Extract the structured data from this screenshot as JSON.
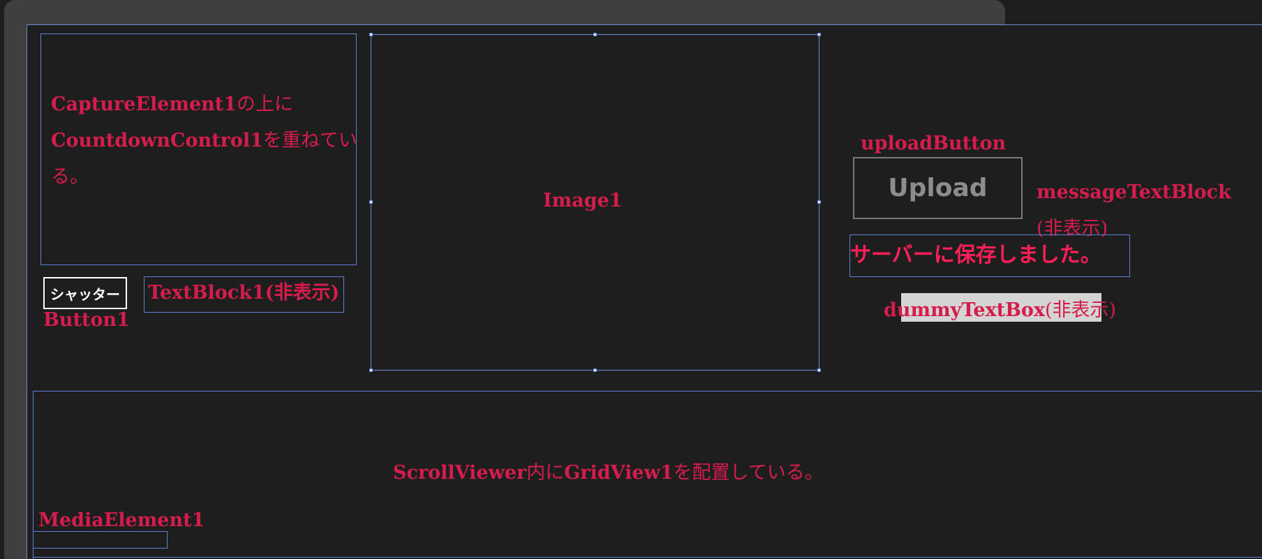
{
  "capture_note": {
    "part1_bold": "CaptureElement1",
    "part1_plain": "の上に",
    "part2_bold": "CountdownControl1",
    "part2_plain": "を重ねている。"
  },
  "shutter_button": {
    "label": "シャッター"
  },
  "button1_label": "Button1",
  "textblock1_label": "TextBlock1(非表示)",
  "image1_label": "Image1",
  "upload_label": "uploadButton",
  "upload_button": {
    "label": "Upload"
  },
  "message_block": {
    "name_bold": "messageTextBlock",
    "name_plain": "(非表示)",
    "text": "サーバーに保存しました。"
  },
  "dummy_textbox": {
    "name_bold": "dummyTextBox",
    "name_plain": "(非表示)"
  },
  "scrollviewer": {
    "part1_bold": "ScrollViewer",
    "part1_plain": "内に",
    "part2_bold": "GridView1",
    "part2_plain": "を配置している。"
  },
  "media_label": "MediaElement1",
  "colors": {
    "label": "#d41d4d",
    "message": "#ff1f57",
    "outline": "#5f84d6",
    "background": "#1e1e1e"
  }
}
